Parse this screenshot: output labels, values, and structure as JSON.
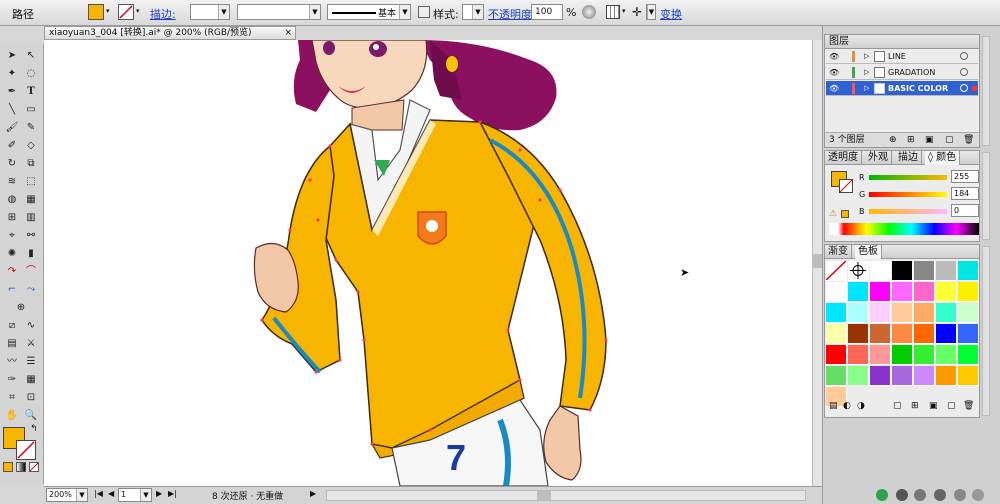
{
  "control_bar": {
    "object_type": "路径",
    "fill_color": "#f7b500",
    "stroke_label": "描边:",
    "stroke_style": "基本",
    "style_label": "样式:",
    "opacity_label": "不透明度:",
    "opacity_value": "100",
    "opacity_unit": "%",
    "transform_label": "变换"
  },
  "document": {
    "tab_title": "xiaoyuan3_004 [转换].ai* @ 200% (RGB/预览)",
    "close": "×"
  },
  "status_bar": {
    "zoom": "200%",
    "page": "1",
    "status_text": "8 次还原 · 无重做"
  },
  "layers_panel": {
    "title": "图层",
    "layers": [
      {
        "name": "LINE",
        "selected": false
      },
      {
        "name": "GRADATION",
        "selected": false
      },
      {
        "name": "BASIC COLOR",
        "selected": true
      }
    ],
    "count": "3 个图层"
  },
  "color_panel": {
    "tabs": [
      "透明度",
      "外观",
      "描边",
      "◊ 颜色"
    ],
    "active_tab": "◊ 颜色",
    "channels": [
      {
        "label": "R",
        "value": "255",
        "fraction": 1.0
      },
      {
        "label": "G",
        "value": "184",
        "fraction": 0.72
      },
      {
        "label": "B",
        "value": "0",
        "fraction": 0.0
      }
    ]
  },
  "swatches_panel": {
    "tabs": [
      "渐变",
      "色板"
    ],
    "active_tab": "色板",
    "colors": [
      "none",
      "registration",
      "#ffffff",
      "#000000",
      "#888888",
      "#bbbbbb",
      "#00e5e5",
      "#ffffff",
      "#00e5ff",
      "#ff00ff",
      "#ff66ff",
      "#ff66cc",
      "#ffff33",
      "#ffee00",
      "#00e6ff",
      "#aaffff",
      "#ffccff",
      "#ffcc99",
      "#ffaa66",
      "#33ffcc",
      "#ccffcc",
      "#ffffaa",
      "#993300",
      "#cc6633",
      "#ff8844",
      "#ff6600",
      "#0000ff",
      "#3366ff",
      "#ff0000",
      "#ff6655",
      "#ff9999",
      "#00cc00",
      "#33ee33",
      "#66ff66",
      "#00ff33",
      "#66dd66",
      "#88ff88",
      "#8833cc",
      "#aa66dd",
      "#cc88ff",
      "#ff9900",
      "#ffcc00",
      "#ffcc99"
    ]
  },
  "artwork": {
    "number_label": "7"
  }
}
